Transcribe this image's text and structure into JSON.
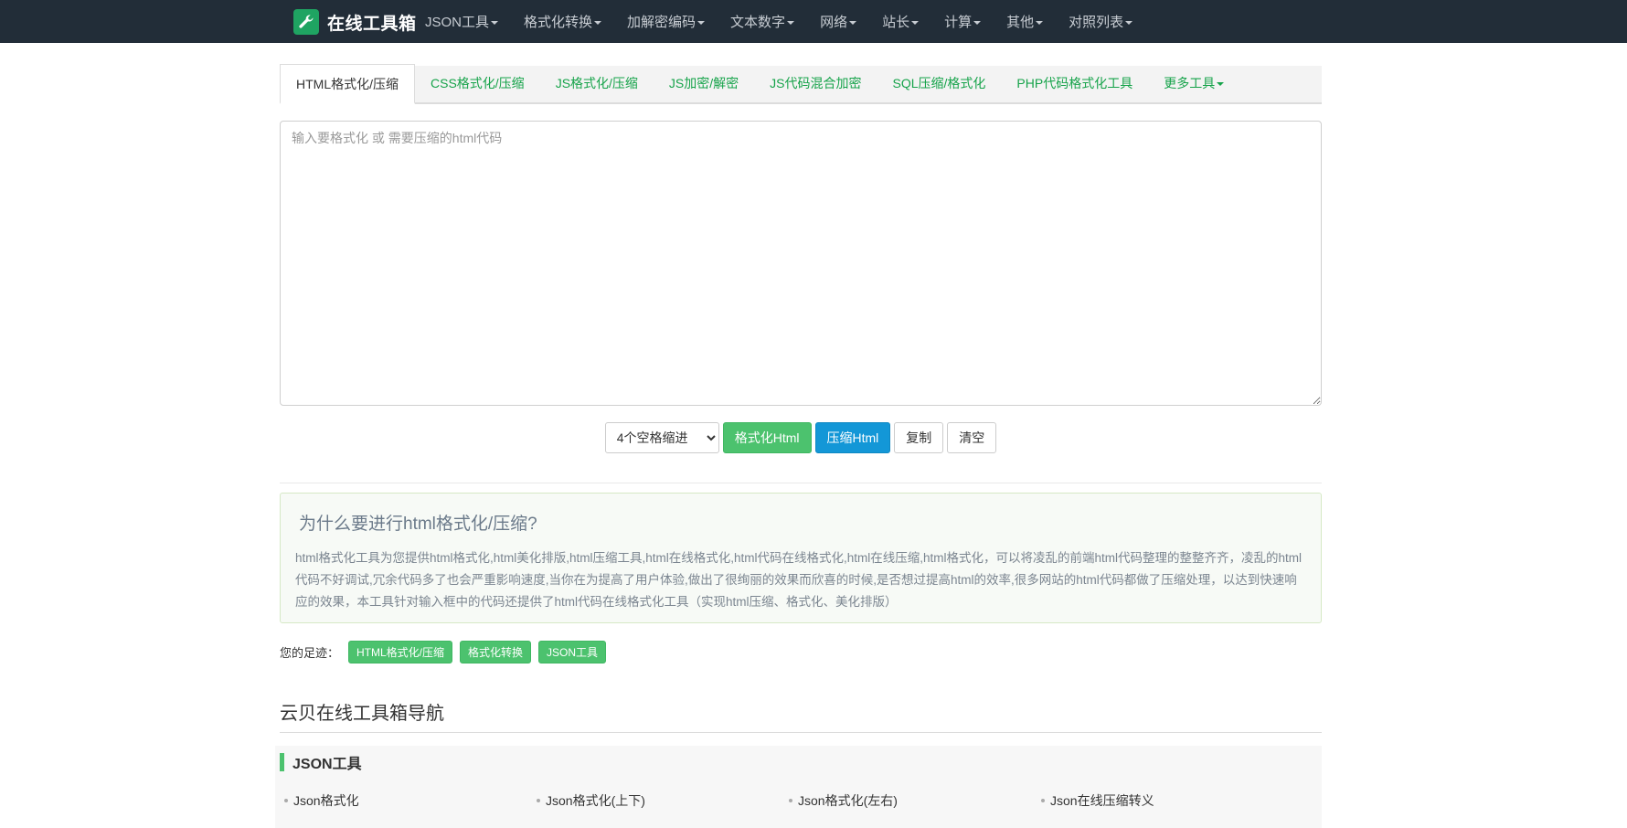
{
  "brand": {
    "title": "在线工具箱",
    "icon": "wrench-icon"
  },
  "nav": [
    {
      "label": "JSON工具"
    },
    {
      "label": "格式化转换"
    },
    {
      "label": "加解密编码"
    },
    {
      "label": "文本数字"
    },
    {
      "label": "网络"
    },
    {
      "label": "站长"
    },
    {
      "label": "计算"
    },
    {
      "label": "其他"
    },
    {
      "label": "对照列表"
    }
  ],
  "tabs": [
    {
      "label": "HTML格式化/压缩",
      "active": true
    },
    {
      "label": "CSS格式化/压缩"
    },
    {
      "label": "JS格式化/压缩"
    },
    {
      "label": "JS加密/解密"
    },
    {
      "label": "JS代码混合加密"
    },
    {
      "label": "SQL压缩/格式化"
    },
    {
      "label": "PHP代码格式化工具"
    },
    {
      "label": "更多工具"
    }
  ],
  "editor": {
    "placeholder": "输入要格式化 或 需要压缩的html代码",
    "value": ""
  },
  "actions": {
    "indent_selected": "4个空格缩进",
    "format_label": "格式化Html",
    "compress_label": "压缩Html",
    "copy_label": "复制",
    "clear_label": "清空"
  },
  "info": {
    "title": "为什么要进行html格式化/压缩?",
    "body": "html格式化工具为您提供html格式化,html美化排版,html压缩工具,html在线格式化,html代码在线格式化,html在线压缩,html格式化，可以将凌乱的前端html代码整理的整整齐齐，凌乱的html代码不好调试,冗余代码多了也会严重影响速度,当你在为提高了用户体验,做出了很绚丽的效果而欣喜的时候,是否想过提高html的效率,很多网站的html代码都做了压缩处理，以达到快速响应的效果，本工具针对输入框中的代码还提供了html代码在线格式化工具（实现html压缩、格式化、美化排版）"
  },
  "footprint": {
    "label": "您的足迹：",
    "tags": [
      "HTML格式化/压缩",
      "格式化转换",
      "JSON工具"
    ]
  },
  "nav_section": {
    "title": "云贝在线工具箱导航",
    "category": "JSON工具",
    "links": [
      "Json格式化",
      "Json格式化(上下)",
      "Json格式化(左右)",
      "Json在线压缩转义"
    ]
  },
  "colors": {
    "navbar": "#222d38",
    "accent_green": "#4cc26e",
    "accent_blue": "#1397d7",
    "tab_link": "#16a34a"
  }
}
